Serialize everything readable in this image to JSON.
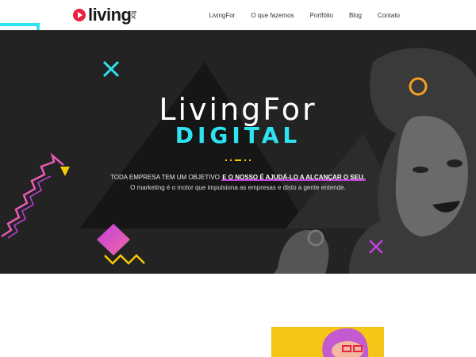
{
  "brand": {
    "name": "living",
    "suffix": "for"
  },
  "nav": {
    "items": [
      {
        "label": "LivingFor"
      },
      {
        "label": "O que fazemos"
      },
      {
        "label": "Portfólio"
      },
      {
        "label": "Blog"
      },
      {
        "label": "Contato"
      }
    ]
  },
  "hero": {
    "title": "LivingFor",
    "subtitle": "DIGITAL",
    "line1_prefix": "TODA EMPRESA TEM UM OBJETIVO ",
    "line1_highlight": "E O NOSSO É AJUDÁ-LO A ALCANÇAR O SEU.",
    "line2": "O marketing é o motor que impulsiona as empresas e disto a gente entende."
  },
  "colors": {
    "brand_red": "#e8223f",
    "hero_bg": "#232323",
    "cyan": "#2de3f2",
    "yellow": "#f6c900",
    "purple": "#c43fe0",
    "orange": "#f4a020"
  }
}
